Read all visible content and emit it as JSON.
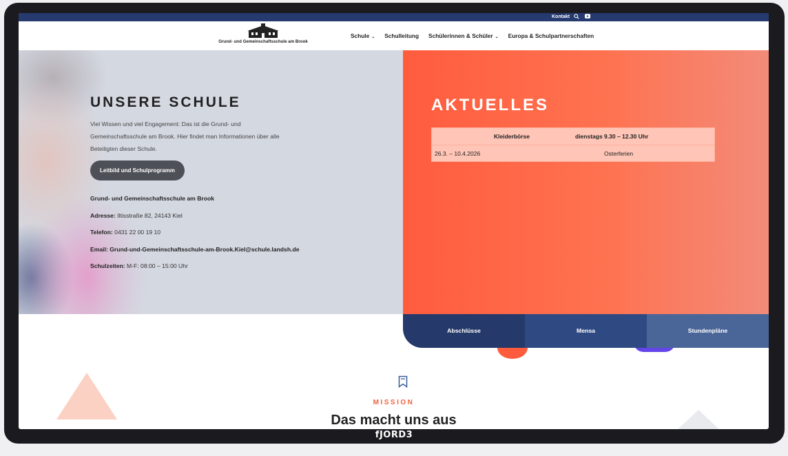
{
  "topbar": {
    "contact_label": "Kontakt",
    "icons": [
      "search-icon",
      "youtube-icon"
    ]
  },
  "header": {
    "logo_text": "Grund- und Gemeinschaftsschule am Brook",
    "nav": [
      {
        "label": "Schule",
        "has_dropdown": true
      },
      {
        "label": "Schulleitung",
        "has_dropdown": false
      },
      {
        "label": "Schülerinnen & Schüler",
        "has_dropdown": true
      },
      {
        "label": "Europa & Schulpartnerschaften",
        "has_dropdown": false
      }
    ]
  },
  "hero": {
    "title": "UNSERE SCHULE",
    "intro": "Viel Wissen und viel Engagement: Das ist die Grund- und Gemeinschaftsschule am Brook. Hier findet man Informationen über alle Beteiligten dieser Schule.",
    "button_label": "Leitbild und Schulprogramm",
    "school_name": "Grund- und Gemeinschaftsschule am Brook",
    "address_label": "Adresse:",
    "address_value": "Iltisstraße 82, 24143 Kiel",
    "phone_label": "Telefon:",
    "phone_value": "0431 22 00 19 10",
    "email_label": "Email:",
    "email_value": "Grund-und-Gemeinschaftsschule-am-Brook.Kiel@schule.landsh.de",
    "hours_label": "Schulzeiten:",
    "hours_value": "M-F: 08:00 – 15:00 Uhr"
  },
  "news": {
    "title": "AKTUELLES",
    "rows": [
      {
        "col1": "Kleiderbörse",
        "col2": "dienstags 9.30 – 12.30 Uhr"
      },
      {
        "col1": "26.3. – 10.4.2026",
        "col2": "Osterferien"
      }
    ]
  },
  "tabs": [
    {
      "label": "Abschlüsse"
    },
    {
      "label": "Mensa"
    },
    {
      "label": "Stundenpläne"
    }
  ],
  "mission": {
    "icon": "bookmark-icon",
    "eyebrow": "MISSION",
    "title": "Das macht uns aus"
  },
  "device": {
    "brand": "fJORD3"
  },
  "colors": {
    "accent": "#ff5c3e",
    "navy": "#263a70",
    "hero_bg": "#d4d8e1"
  }
}
